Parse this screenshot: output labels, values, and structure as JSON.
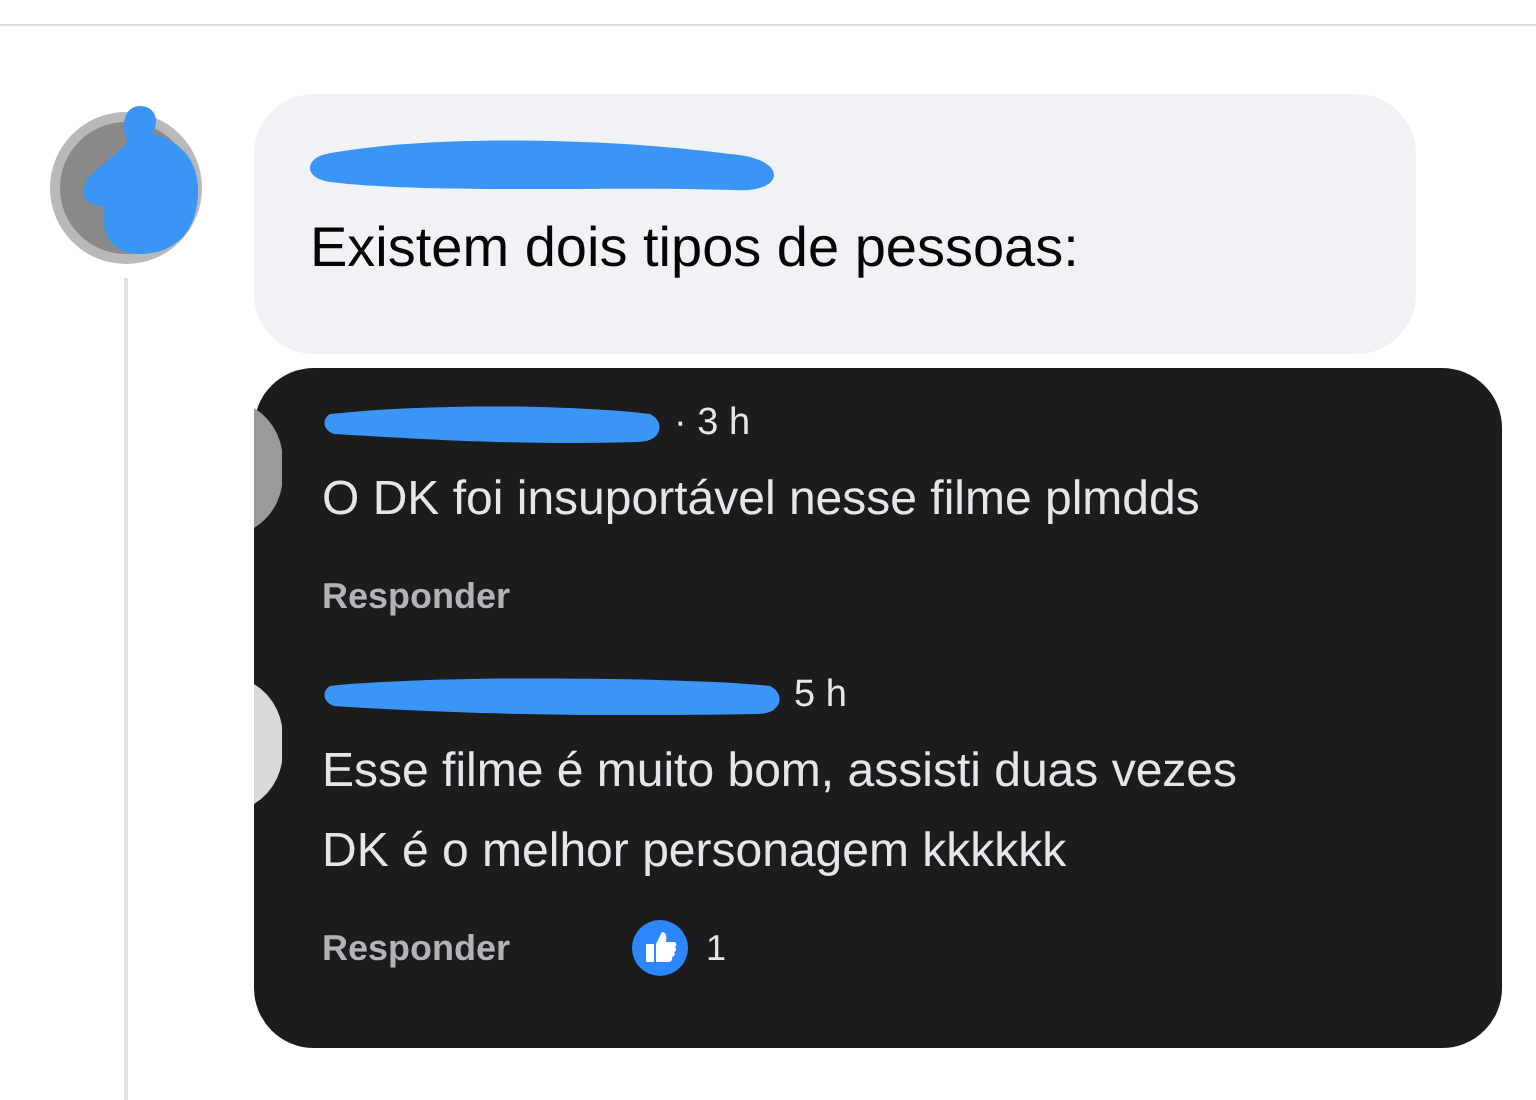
{
  "comment": {
    "text": "Existem dois tipos de pessoas:"
  },
  "replies": [
    {
      "time": "· 3 h",
      "lines": [
        "O DK foi insuportável nesse filme plmdds"
      ],
      "reply_label": "Responder"
    },
    {
      "time": "5 h",
      "lines": [
        "Esse filme é muito bom, assisti duas vezes",
        "DK é o melhor personagem kkkkkk"
      ],
      "reply_label": "Responder",
      "likes": "1"
    }
  ]
}
